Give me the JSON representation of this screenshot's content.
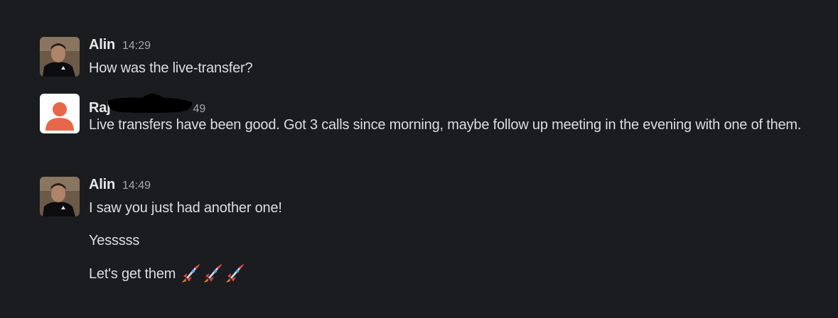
{
  "messages": [
    {
      "author": "Alin",
      "time": "14:29",
      "lines": [
        "How was the live-transfer?"
      ]
    },
    {
      "author": "Raj",
      "time": "49",
      "author_redacted": true,
      "lines": [
        "Live transfers have been good. Got 3 calls since morning, maybe follow up meeting in the evening with one of them."
      ]
    },
    {
      "author": "Alin",
      "time": "14:49",
      "lines": [
        "I saw you just had another one!",
        "Yesssss",
        "Let's get them"
      ],
      "trailing_emoji": [
        "rocket-emoji",
        "rocket-emoji",
        "rocket-emoji"
      ]
    }
  ],
  "colors": {
    "background": "#1b1c20",
    "text": "#dcdddd",
    "timestamp": "#a6a7a9",
    "default_avatar_bg": "#e8674a",
    "default_avatar_fg": "#ffffff"
  }
}
